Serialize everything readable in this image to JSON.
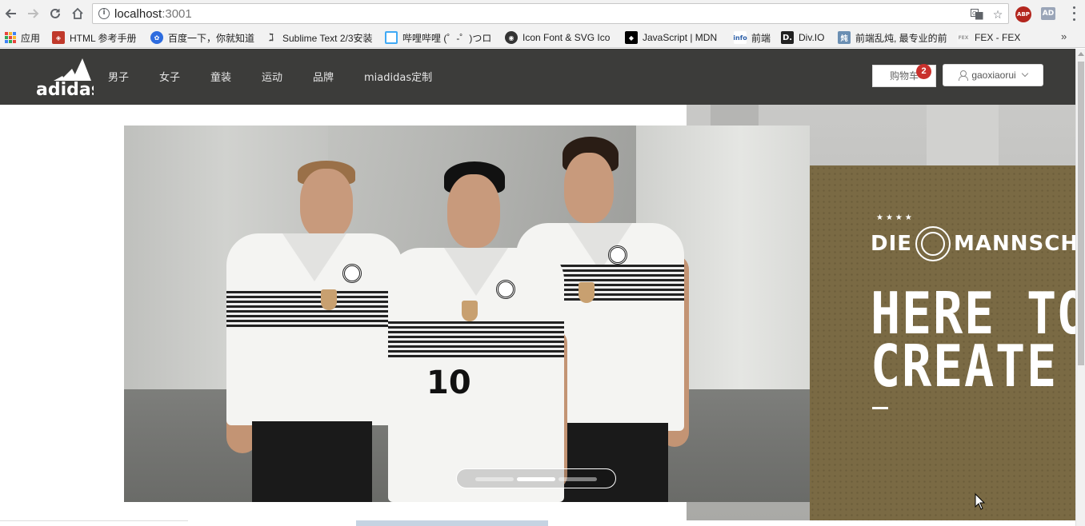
{
  "browser": {
    "url_host": "localhost",
    "url_port": ":3001",
    "bookmarks": [
      {
        "label": "应用",
        "icon": "apps-grid-icon",
        "color": "#e04a3f"
      },
      {
        "label": "HTML 参考手册",
        "icon": "w3school-icon",
        "color": "#c0392b"
      },
      {
        "label": "百度一下，你就知道",
        "icon": "baidu-paw-icon",
        "color": "#2d6cdf"
      },
      {
        "label": "Sublime Text 2/3安装",
        "icon": "sublime-icon",
        "color": "#444444"
      },
      {
        "label": "哔哩哔哩 (゜-゜)つロ",
        "icon": "bilibili-tv-icon",
        "color": "#3fa9f5"
      },
      {
        "label": "Icon Font & SVG Ico",
        "icon": "iconfont-icon",
        "color": "#333333"
      },
      {
        "label": "JavaScript | MDN",
        "icon": "mdn-icon",
        "color": "#000000"
      },
      {
        "label": "前端",
        "icon": "info-icon",
        "color": "#2c5fa8"
      },
      {
        "label": "Div.IO",
        "icon": "divio-icon",
        "color": "#222222"
      },
      {
        "label": "前端乱炖, 最专业的前",
        "icon": "luandun-icon",
        "color": "#6b8fb3"
      },
      {
        "label": "FEX - FEX",
        "icon": "fex-icon",
        "color": "#999999"
      }
    ],
    "extensions": {
      "abp": "ABP",
      "ad": "AD"
    },
    "more": "»"
  },
  "header": {
    "brand": "adidas",
    "nav": [
      "男子",
      "女子",
      "童装",
      "运动",
      "品牌",
      "miadidas定制"
    ],
    "cart_label": "购物车",
    "cart_count": "2",
    "username": "gaoxiaorui"
  },
  "hero": {
    "jersey_number": "10",
    "banner_title": "DIE MANNSCH",
    "banner_title_left": "DIE",
    "banner_title_right": "MANNSCH",
    "banner_stars": "★★★★",
    "headline_line1": "HERE TO",
    "headline_line2": "CREATE",
    "carousel_slides": 3,
    "carousel_active_index": 2
  },
  "colors": {
    "header_bg": "#3c3c3a",
    "olive": "#7a6a44",
    "badge_red": "#c9302c"
  }
}
